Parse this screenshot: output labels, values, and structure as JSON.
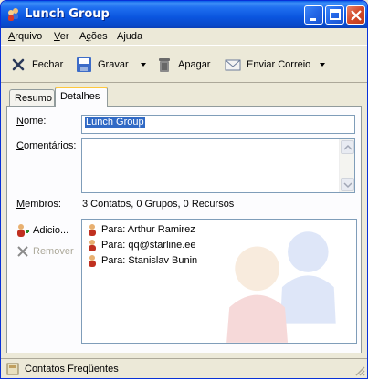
{
  "window": {
    "title": "Lunch Group"
  },
  "menubar": {
    "items": [
      {
        "label": "Arquivo",
        "accel": "A",
        "rest": "rquivo"
      },
      {
        "label": "Ver",
        "accel": "V",
        "rest": "er"
      },
      {
        "label": "Ações",
        "accel": "ç",
        "pre": "A",
        "rest": "ões"
      },
      {
        "label": "Ajuda",
        "accel": "j",
        "pre": "A",
        "rest": "uda"
      }
    ]
  },
  "toolbar": {
    "close_label": "Fechar",
    "save_label": "Gravar",
    "delete_label": "Apagar",
    "send_label": "Enviar Correio"
  },
  "tabs": [
    {
      "label": "Resumo",
      "active": false
    },
    {
      "label": "Detalhes",
      "active": true
    }
  ],
  "form": {
    "name_label": "Nome:",
    "name_value": "Lunch Group",
    "comments_label": "Comentários:",
    "comments_value": "",
    "members_label": "Membros:",
    "members_summary": "3 Contatos, 0 Grupos, 0 Recursos",
    "add_label": "Adicio...",
    "remove_label": "Remover"
  },
  "members": [
    {
      "label": "Para: Arthur Ramirez"
    },
    {
      "label": "Para: qq@starline.ee"
    },
    {
      "label": "Para: Stanislav Bunin"
    }
  ],
  "statusbar": {
    "text": "Contatos Freqüentes"
  },
  "colors": {
    "titlebar": "#0A55DF",
    "selection": "#316AC5",
    "tab_highlight": "#FFC83C"
  }
}
